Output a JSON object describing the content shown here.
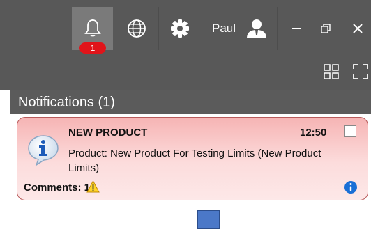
{
  "topbar": {
    "notification_count": "1",
    "username": "Paul",
    "icons": [
      "bell-icon",
      "globe-icon",
      "gear-icon",
      "user-icon",
      "minimize-icon",
      "restore-icon",
      "close-icon"
    ]
  },
  "toolbar": {
    "icons": [
      "grid-view-icon",
      "fullscreen-icon"
    ]
  },
  "notifications": {
    "title": "Notifications (1)",
    "items": [
      {
        "title": "NEW PRODUCT",
        "time": "12:50",
        "body": "Product: New Product For Testing Limits (New Product Limits)",
        "comments_label": "Comments: 1",
        "checked": false
      }
    ]
  },
  "colors": {
    "topbar": "#585858",
    "badge": "#e0141a",
    "card_top": "#f6b4b4",
    "card_bottom": "#fde8e8",
    "info_blue": "#1a6fd6"
  }
}
